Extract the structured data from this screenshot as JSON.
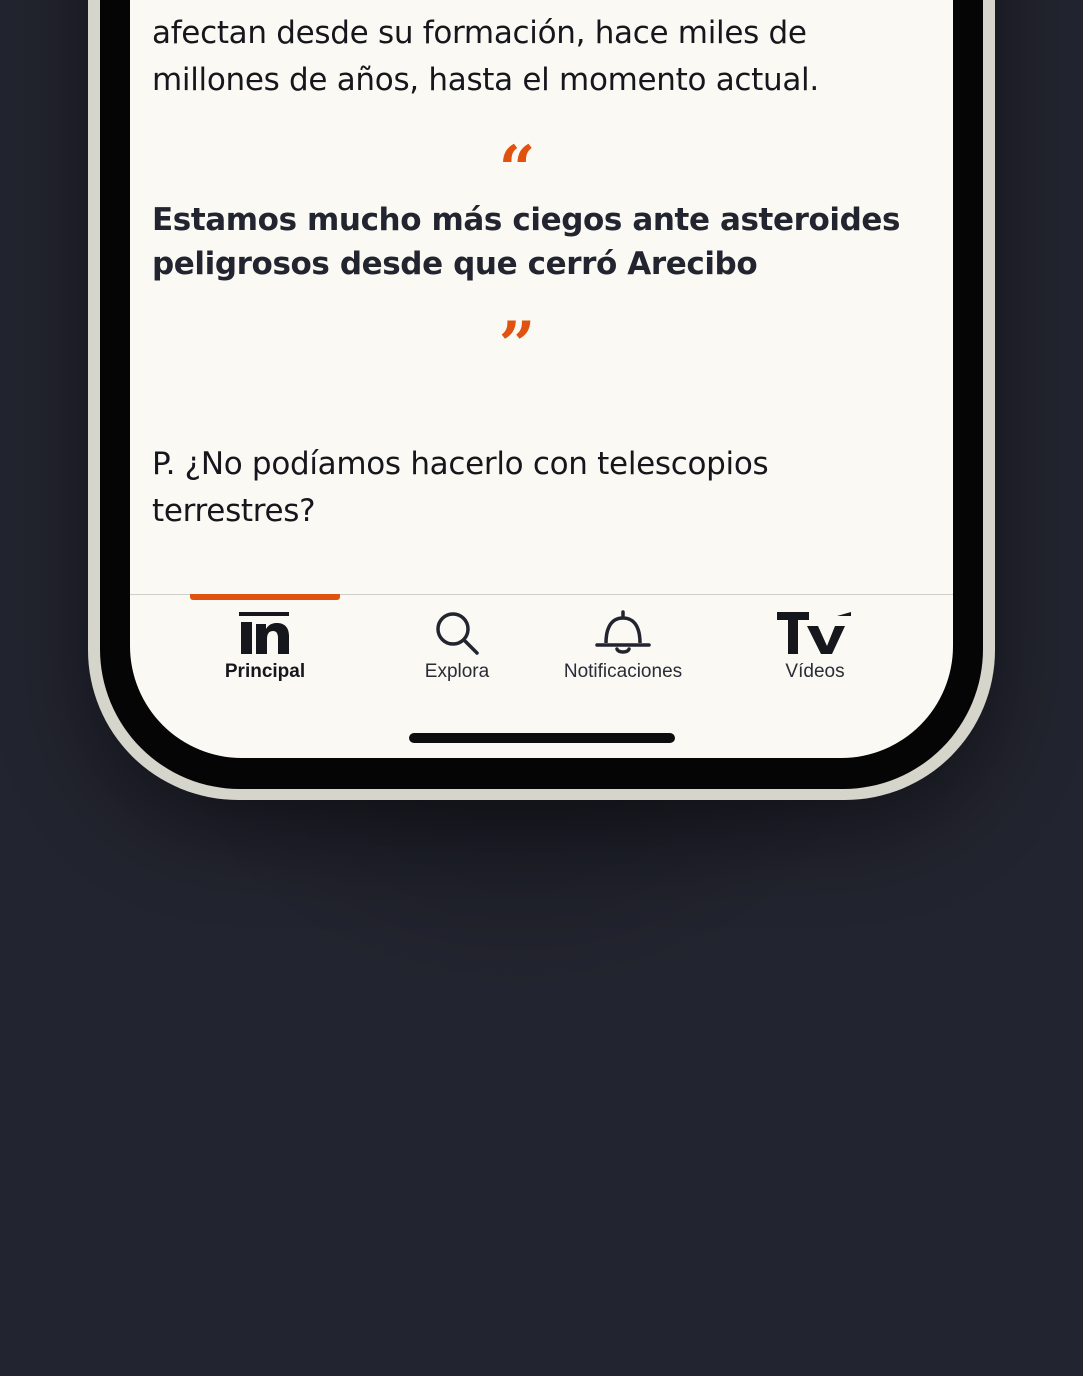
{
  "article": {
    "intro_text": "afectan desde su formación, hace miles de millones de años, hasta el momento actual.",
    "quote_open": "“",
    "pull_quote": "Estamos mucho más ciegos ante asteroides peligrosos desde que cerró Arecibo",
    "quote_close": "”",
    "question_text": "P. ¿No podíamos hacerlo con telescopios terrestres?"
  },
  "tabbar": {
    "active_tab": "Principal",
    "accent_color": "#e0520f",
    "tabs": [
      {
        "label": "Principal",
        "icon": "in-logo-icon"
      },
      {
        "label": "Explora",
        "icon": "search-icon"
      },
      {
        "label": "Notificaciones",
        "icon": "bell-icon"
      },
      {
        "label": "Vídeos",
        "icon": "tv-logo-icon"
      }
    ]
  },
  "colors": {
    "background": "#22242f",
    "screen": "#faf9f4",
    "text": "#16161d",
    "frame": "#d6d5cc"
  }
}
